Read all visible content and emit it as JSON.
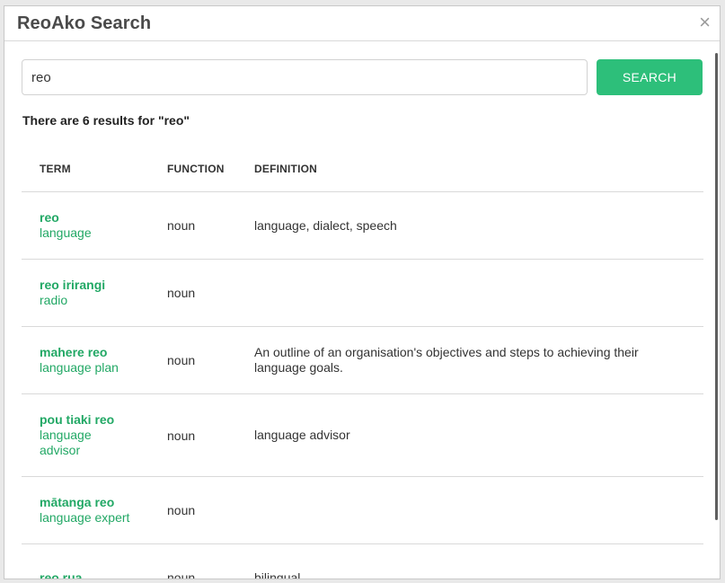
{
  "dialog": {
    "title": "ReoAko Search",
    "close_glyph": "×"
  },
  "search": {
    "value": "reo",
    "placeholder": "",
    "button_label": "SEARCH"
  },
  "results": {
    "summary": "There are 6 results for \"reo\"",
    "columns": {
      "term": "TERM",
      "function": "FUNCTION",
      "definition": "DEFINITION"
    },
    "rows": [
      {
        "term": "reo",
        "translation": "language",
        "function": "noun",
        "definition": "language, dialect, speech"
      },
      {
        "term": "reo irirangi",
        "translation": "radio",
        "function": "noun",
        "definition": ""
      },
      {
        "term": "mahere reo",
        "translation": "language plan",
        "function": "noun",
        "definition": "An outline of an organisation's objectives and steps to achieving their language goals."
      },
      {
        "term": "pou tiaki reo",
        "translation": "language advisor",
        "function": "noun",
        "definition": "language advisor"
      },
      {
        "term": "mātanga reo",
        "translation": "language expert",
        "function": "noun",
        "definition": ""
      },
      {
        "term": "reo rua",
        "translation": "",
        "function": "noun",
        "definition": "bilingual"
      }
    ]
  },
  "colors": {
    "accent": "#2dbf7a",
    "term_link": "#22a865"
  }
}
